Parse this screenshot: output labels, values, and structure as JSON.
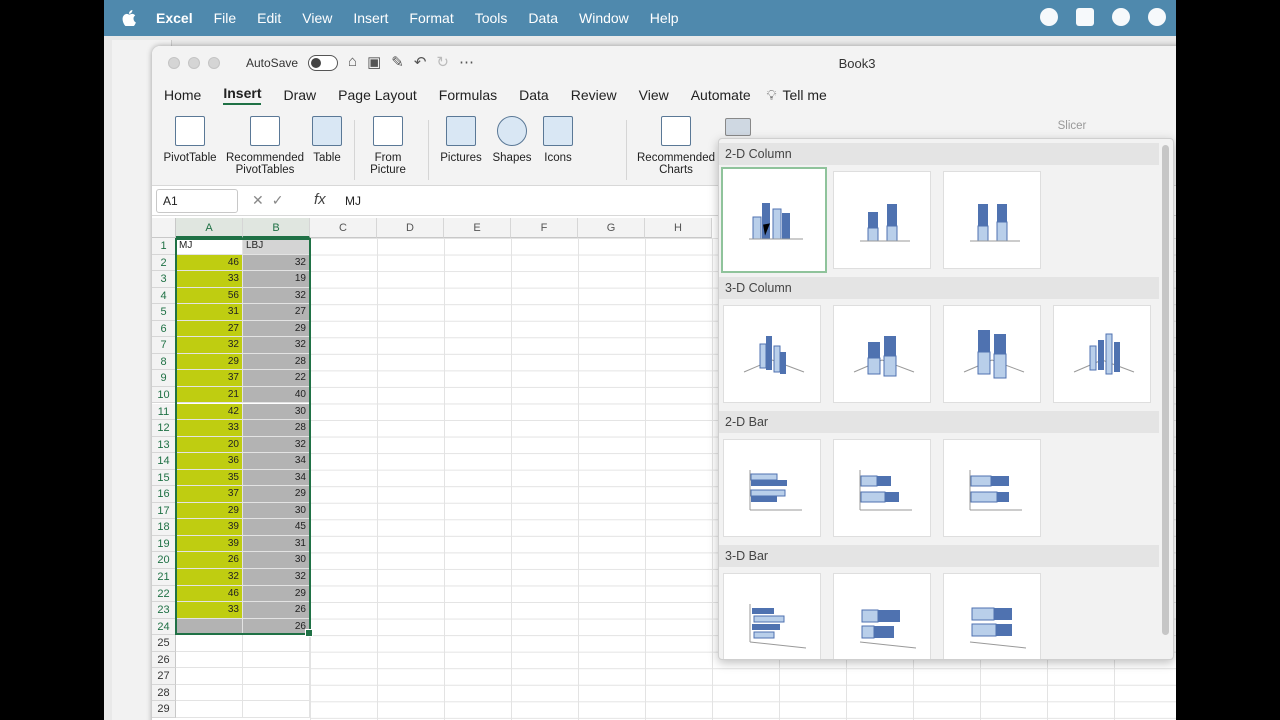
{
  "menubar": {
    "app": "Excel",
    "items": [
      "File",
      "Edit",
      "View",
      "Insert",
      "Format",
      "Tools",
      "Data",
      "Window",
      "Help"
    ]
  },
  "window": {
    "autosave": "AutoSave",
    "title": "Book3"
  },
  "tabs": [
    "Home",
    "Insert",
    "Draw",
    "Page Layout",
    "Formulas",
    "Data",
    "Review",
    "View",
    "Automate",
    "Tell me"
  ],
  "active_tab": "Insert",
  "ribbon": {
    "pivot": "PivotTable",
    "recommended_pivot": "Recommended PivotTables",
    "table": "Table",
    "from_picture": "From Picture",
    "pictures": "Pictures",
    "shapes": "Shapes",
    "icons": "Icons",
    "recommended_charts": "Recommended Charts",
    "slicer": "Slicer"
  },
  "formula_bar": {
    "name_box": "A1",
    "fx": "fx",
    "value": "MJ"
  },
  "columns": [
    "A",
    "B",
    "C",
    "D",
    "E",
    "F",
    "G",
    "H"
  ],
  "sheet": {
    "headers": [
      "MJ",
      "LBJ"
    ],
    "mj": [
      46,
      33,
      56,
      31,
      27,
      32,
      29,
      37,
      21,
      42,
      33,
      20,
      36,
      35,
      37,
      29,
      39,
      39,
      26,
      32,
      46,
      33
    ],
    "lbj": [
      32,
      19,
      32,
      27,
      29,
      32,
      28,
      22,
      40,
      30,
      28,
      32,
      34,
      34,
      29,
      30,
      45,
      31,
      30,
      32,
      29,
      26,
      26
    ]
  },
  "chart_panel": {
    "sections": [
      "2-D Column",
      "3-D Column",
      "2-D Bar",
      "3-D Bar"
    ],
    "selected": "Clustered Column"
  },
  "colors": {
    "mj_fill": "#bfcd11",
    "lbj_fill": "#b3b3b3",
    "accent": "#1f7145",
    "chart_blue": "#4f72b0",
    "chart_light": "#b9cfea"
  }
}
